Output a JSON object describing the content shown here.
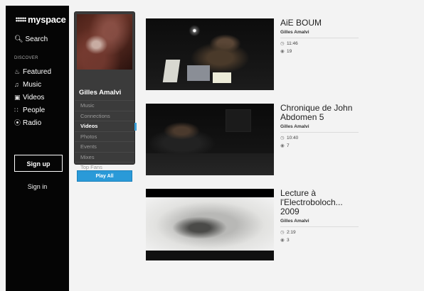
{
  "nav": {
    "logo": "myspace",
    "search": "Search",
    "section_label": "DISCOVER",
    "items": [
      {
        "label": "Featured",
        "icon": "flame-icon"
      },
      {
        "label": "Music",
        "icon": "music-note-icon"
      },
      {
        "label": "Videos",
        "icon": "video-icon"
      },
      {
        "label": "People",
        "icon": "people-icon"
      },
      {
        "label": "Radio",
        "icon": "radio-icon"
      }
    ],
    "signup": "Sign up",
    "signin": "Sign in"
  },
  "profile": {
    "name": "Gilles Amalvi",
    "menu": [
      "Music",
      "Connections",
      "Videos",
      "Photos",
      "Events",
      "Mixes",
      "Top Fans"
    ],
    "active_item": "Videos",
    "play_all": "Play All"
  },
  "videos": [
    {
      "title": "AiE BOUM",
      "author": "Gilles Amalvi",
      "duration": "11:46",
      "count": "19"
    },
    {
      "title": "Chronique de John Abdomen 5",
      "author": "Gilles Amalvi",
      "duration": "10:40",
      "count": "7"
    },
    {
      "title": "Lecture à l'Electroboloch... 2009",
      "author": "Gilles Amalvi",
      "duration": "2:19",
      "count": "3"
    }
  ],
  "colors": {
    "accent": "#2a9ad8",
    "nav_bg": "#050505",
    "card_bg": "#3b3b3b",
    "page_bg": "#f3f3f3"
  }
}
